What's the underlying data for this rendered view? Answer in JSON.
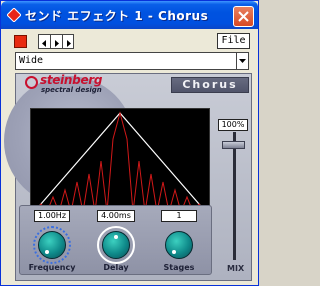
{
  "window": {
    "title": "センド エフェクト 1 - Chorus"
  },
  "toolbar": {
    "file_label": "File",
    "icons": [
      "bypass-icon",
      "prev-arrow-icon",
      "next-arrow-icon"
    ]
  },
  "preset": {
    "value": "Wide"
  },
  "plugin": {
    "brand": "steinberg",
    "brand_sub": "spectral design",
    "fx_name": "Chorus",
    "colors": {
      "accent": "#c8102e",
      "panel": "#b4b8c8",
      "knob": "#0f8a8a"
    }
  },
  "controls": [
    {
      "label": "Frequency",
      "value": "1.00Hz"
    },
    {
      "label": "Delay",
      "value": "4.00ms"
    },
    {
      "label": "Stages",
      "value": "1"
    }
  ],
  "mix": {
    "value": "100%",
    "label": "MIX",
    "level": 1.0
  }
}
